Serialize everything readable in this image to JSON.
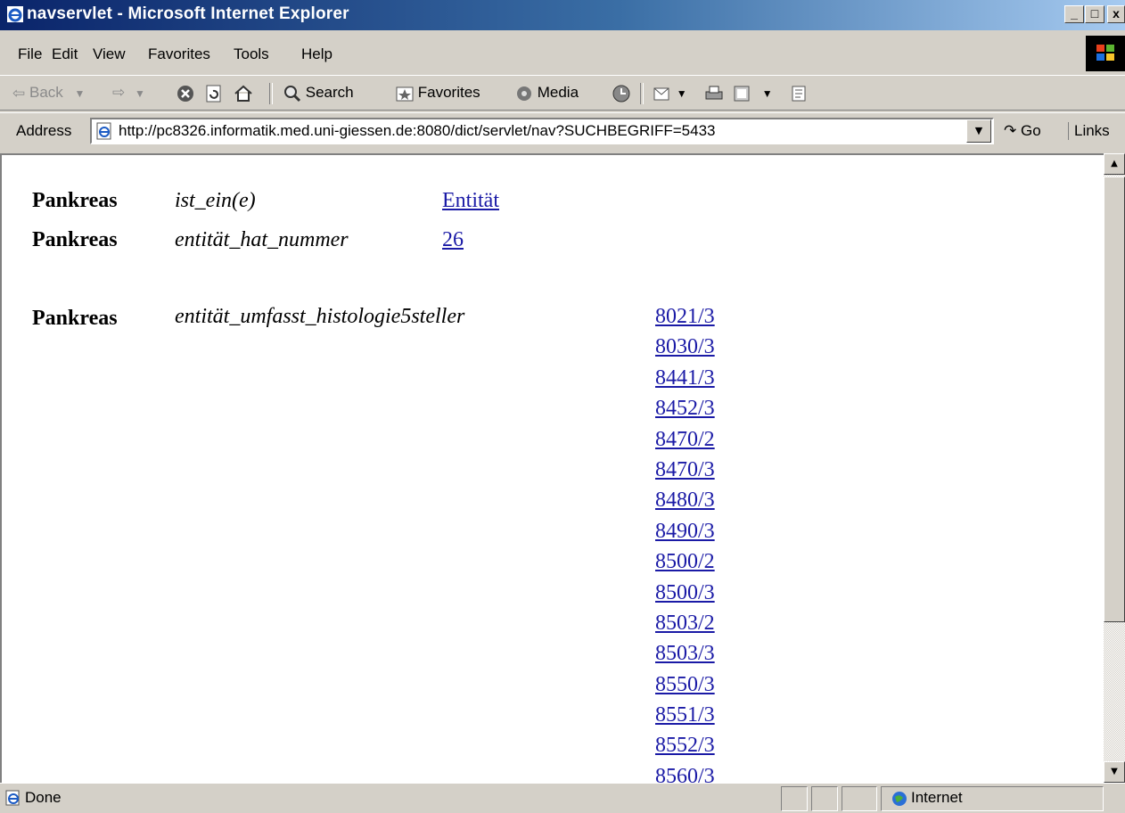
{
  "window": {
    "title": "navservlet - Microsoft Internet Explorer",
    "controls": [
      "_",
      "□",
      "x"
    ]
  },
  "menu": [
    "File",
    "Edit",
    "View",
    "Favorites",
    "Tools",
    "Help"
  ],
  "toolbar": {
    "back_label": "Back",
    "search_label": "Search",
    "favorites_label": "Favorites",
    "media_label": "Media"
  },
  "address": {
    "label": "Address",
    "url": "http://pc8326.informatik.med.uni-giessen.de:8080/dict/servlet/nav?SUCHBEGRIFF=5433",
    "go_label": "Go",
    "links_label": "Links"
  },
  "content": {
    "triples": [
      {
        "subject": "Pankreas",
        "predicate": "ist_ein(e)",
        "object": "Entität"
      },
      {
        "subject": "Pankreas",
        "predicate": "entität_hat_nummer",
        "object": "26"
      }
    ],
    "multi": {
      "subject": "Pankreas",
      "predicate": "entität_umfasst_histologie5steller",
      "values": [
        "8021/3",
        "8030/3",
        "8441/3",
        "8452/3",
        "8470/2",
        "8470/3",
        "8480/3",
        "8490/3",
        "8500/2",
        "8500/3",
        "8503/2",
        "8503/3",
        "8550/3",
        "8551/3",
        "8552/3",
        "8560/3"
      ]
    }
  },
  "status": {
    "text": "Done",
    "zone": "Internet"
  },
  "colors": {
    "link": "#1a1aa6",
    "titlebar_start": "#0a246a",
    "titlebar_end": "#a6caf0",
    "chrome": "#d4d0c8"
  }
}
